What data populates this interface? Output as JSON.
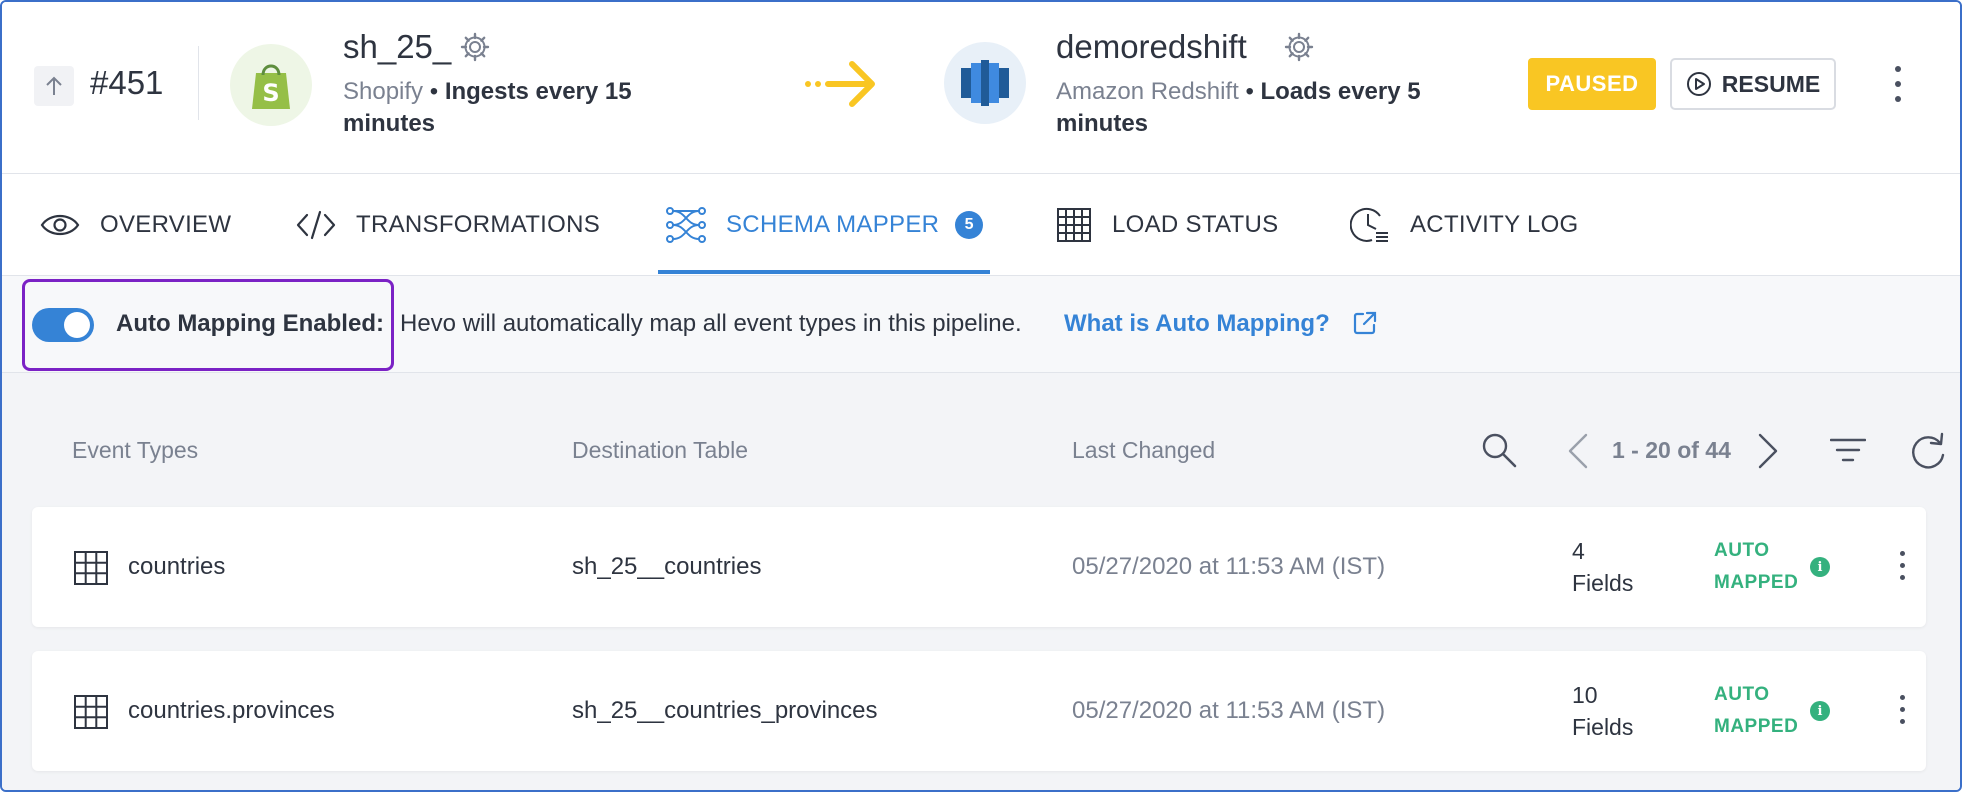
{
  "pipeline": {
    "id": "#451",
    "status": "PAUSED",
    "resume_label": "RESUME"
  },
  "source": {
    "name": "sh_25_",
    "type": "Shopify",
    "separator": "•",
    "frequency": "Ingests every 15 minutes",
    "logo_icon": "shopify-bag-icon"
  },
  "destination": {
    "name": "demoredshift",
    "type": "Amazon Redshift",
    "separator": "•",
    "frequency": "Loads every 5 minutes",
    "logo_icon": "redshift-icon"
  },
  "tabs": [
    {
      "label": "OVERVIEW",
      "icon": "eye-icon"
    },
    {
      "label": "TRANSFORMATIONS",
      "icon": "code-icon"
    },
    {
      "label": "SCHEMA MAPPER",
      "icon": "schema-icon",
      "badge": "5",
      "active": true
    },
    {
      "label": "LOAD STATUS",
      "icon": "grid-icon"
    },
    {
      "label": "ACTIVITY LOG",
      "icon": "clock-log-icon"
    }
  ],
  "banner": {
    "label": "Auto Mapping Enabled:",
    "text": "Hevo will automatically map all event types in this pipeline.",
    "link": "What is Auto Mapping?",
    "toggle_on": true
  },
  "table": {
    "columns": [
      "Event Types",
      "Destination Table",
      "Last Changed"
    ],
    "pagination": "1 - 20 of 44",
    "rows": [
      {
        "event_type": "countries",
        "destination": "sh_25__countries",
        "last_changed": "05/27/2020 at 11:53 AM (IST)",
        "fields_count": "4",
        "fields_label": "Fields",
        "status_line1": "AUTO",
        "status_line2": "MAPPED",
        "info": "i"
      },
      {
        "event_type": "countries.provinces",
        "destination": "sh_25__countries_provinces",
        "last_changed": "05/27/2020 at 11:53 AM (IST)",
        "fields_count": "10",
        "fields_label": "Fields",
        "status_line1": "AUTO",
        "status_line2": "MAPPED",
        "info": "i"
      }
    ]
  },
  "colors": {
    "accent": "#3583d6",
    "paused": "#f9c623",
    "auto_mapped": "#34b17e",
    "highlight": "#7b22c5"
  }
}
